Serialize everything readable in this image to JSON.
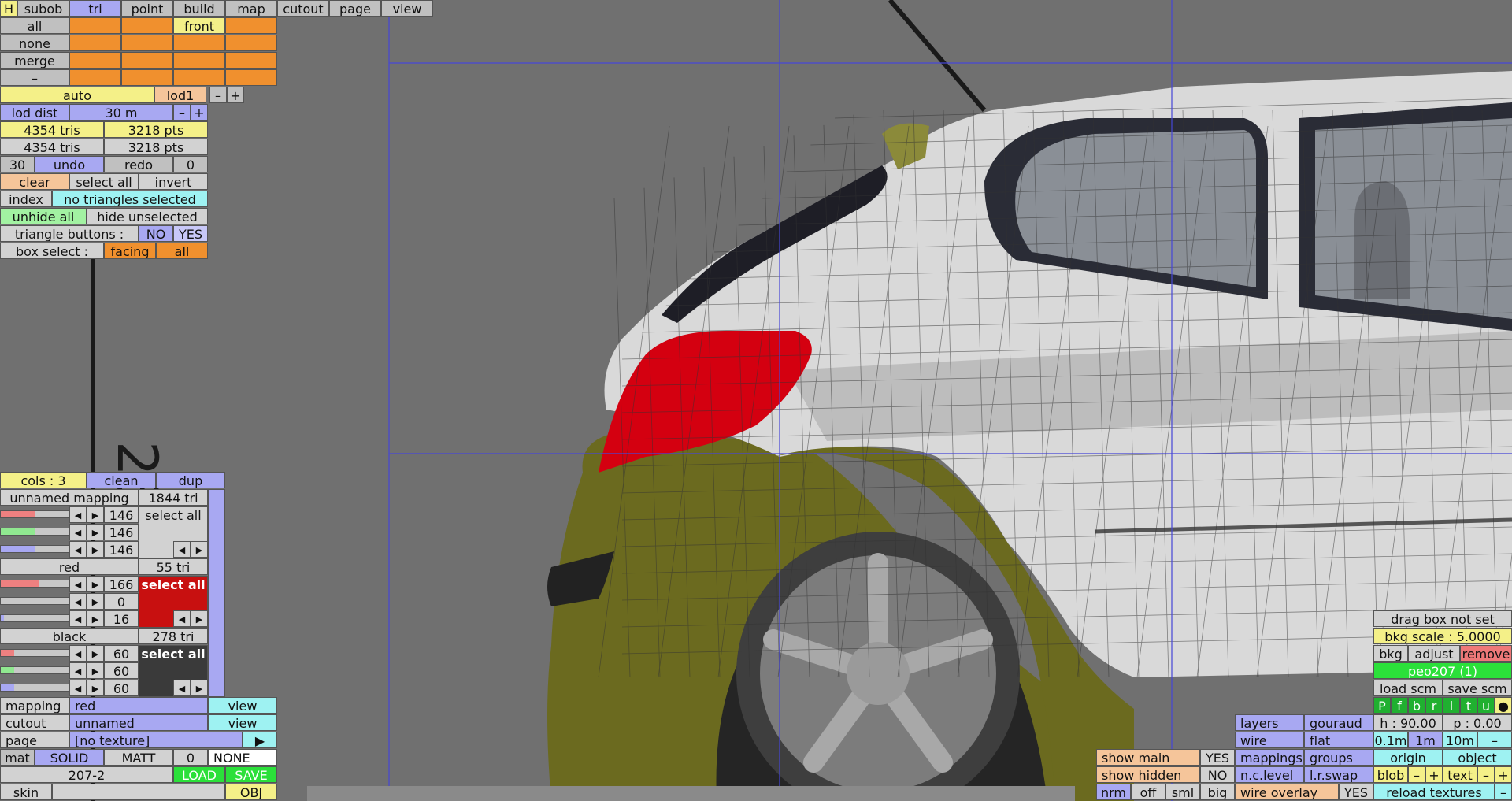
{
  "top_menu": {
    "h": "H",
    "subob": "subob",
    "tri": "tri",
    "point": "point",
    "build": "build",
    "map": "map",
    "cutout": "cutout",
    "page": "page",
    "view": "view"
  },
  "select_rows": {
    "all": "all",
    "none": "none",
    "merge": "merge",
    "minus": "–",
    "front": "front"
  },
  "lod": {
    "auto": "auto",
    "lod1": "lod1",
    "minus": "–",
    "plus": "+",
    "dist_label": "lod dist",
    "dist_value": "30 m"
  },
  "stats": {
    "tris1": "4354 tris",
    "pts1": "3218 pts",
    "tris2": "4354 tris",
    "pts2": "3218 pts"
  },
  "undo_row": {
    "undo_count": "30",
    "undo": "undo",
    "redo": "redo",
    "redo_count": "0"
  },
  "select_row": {
    "clear": "clear",
    "select_all": "select all",
    "invert": "invert"
  },
  "index_row": {
    "index": "index",
    "status": "no triangles selected"
  },
  "hide_row": {
    "unhide_all": "unhide all",
    "hide_unselected": "hide unselected"
  },
  "tri_buttons": {
    "label": "triangle buttons :",
    "no": "NO",
    "yes": "YES"
  },
  "box_select": {
    "label": "box select :",
    "facing": "facing",
    "all": "all"
  },
  "cols": {
    "label": "cols : 3",
    "clean": "clean",
    "dup": "dup"
  },
  "mappings": [
    {
      "name": "unnamed mapping",
      "tri": "1844 tri",
      "r": "146",
      "g": "146",
      "b": "146",
      "select": "select all",
      "r_frac": 0.5,
      "g_frac": 0.5,
      "b_frac": 0.5
    },
    {
      "name": "red",
      "tri": "55 tri",
      "r": "166",
      "g": "0",
      "b": "16",
      "select": "select all",
      "r_frac": 0.57,
      "g_frac": 0.0,
      "b_frac": 0.05
    },
    {
      "name": "black",
      "tri": "278 tri",
      "r": "60",
      "g": "60",
      "b": "60",
      "select": "select all",
      "r_frac": 0.2,
      "g_frac": 0.2,
      "b_frac": 0.2
    }
  ],
  "bottom_left": {
    "mapping_label": "mapping",
    "mapping_value": "red",
    "mapping_view": "view",
    "cutout_label": "cutout",
    "cutout_value": "unnamed",
    "cutout_view": "view",
    "page_label": "page",
    "page_value": "[no texture]",
    "page_arrow": "▶",
    "mat": "mat",
    "solid": "SOLID",
    "matt": "MATT",
    "mat_num": "0",
    "none": "NONE",
    "file": "207-2",
    "load": "LOAD",
    "save": "SAVE",
    "skin": "skin",
    "obj": "OBJ"
  },
  "right_panel": {
    "drag_box": "drag box not set",
    "bkg_scale": "bkg scale : 5.0000",
    "bkg": "bkg",
    "adjust": "adjust",
    "remove": "remove",
    "model": "peo207 (1)",
    "load_scm": "load scm",
    "save_scm": "save scm",
    "views": [
      "P",
      "f",
      "b",
      "r",
      "l",
      "t",
      "u",
      "●"
    ],
    "layers": "layers",
    "gouraud": "gouraud",
    "h": "h : 90.00",
    "p": "p : 0.00",
    "wire": "wire",
    "flat": "flat",
    "s01": "0.1m",
    "s1": "1m",
    "s10": "10m",
    "sminus": "–",
    "mappings": "mappings",
    "groups": "groups",
    "origin": "origin",
    "object": "object",
    "nclevel": "n.c.level",
    "lrswap": "l.r.swap",
    "blob": "blob",
    "bminus": "–",
    "bplus": "+",
    "text": "text",
    "tminus": "–",
    "tplus": "+",
    "wire_overlay": "wire overlay",
    "wo_yes": "YES",
    "reload": "reload textures",
    "rminus": "–",
    "nrm": "nrm",
    "off": "off",
    "sml": "sml",
    "big": "big"
  },
  "show_panel": {
    "show_main": "show main",
    "main_yes": "YES",
    "show_hidden": "show hidden",
    "hidden_no": "NO"
  },
  "colors": {
    "background": "#707070",
    "car_white": "#d9d9d9",
    "car_olive": "#6b6a1f",
    "taillight": "#d40010",
    "guide": "#4646d8"
  }
}
